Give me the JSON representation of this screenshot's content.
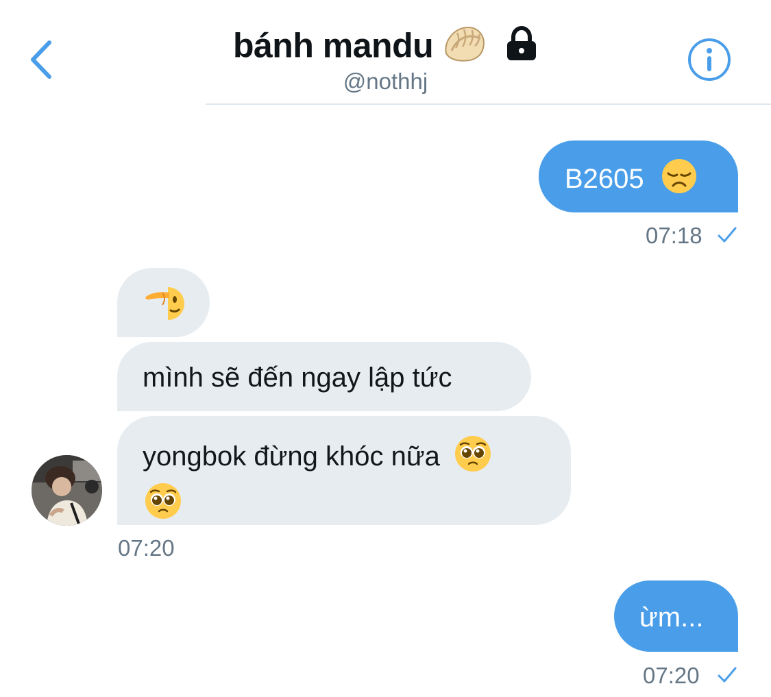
{
  "header": {
    "back_icon": "chevron-left-icon",
    "title": "bánh mandu",
    "title_emoji": "dumpling-emoji",
    "lock_icon": "lock-icon",
    "handle": "@nothhj",
    "info_icon": "info-icon"
  },
  "colors": {
    "accent": "#4a9ee9",
    "incoming_bubble": "#e6ecf0",
    "meta_text": "#657786",
    "title_text": "#0f1419"
  },
  "messages": [
    {
      "direction": "outgoing",
      "text": "B2605",
      "emoji": "disappointed-face-emoji"
    },
    {
      "direction": "outgoing_meta",
      "time": "07:18",
      "status_icon": "check-icon"
    },
    {
      "direction": "incoming",
      "emoji": "saluting-face-emoji"
    },
    {
      "direction": "incoming",
      "text": "mình sẽ đến ngay lập tức"
    },
    {
      "direction": "incoming",
      "text": "yongbok đừng khóc nữa",
      "emoji": "pleading-face-emoji"
    },
    {
      "direction": "incoming_meta",
      "time": "07:20",
      "avatar": "avatar"
    },
    {
      "direction": "outgoing",
      "text": "ừm..."
    },
    {
      "direction": "outgoing_meta",
      "time": "07:20",
      "status_icon": "check-icon"
    }
  ]
}
